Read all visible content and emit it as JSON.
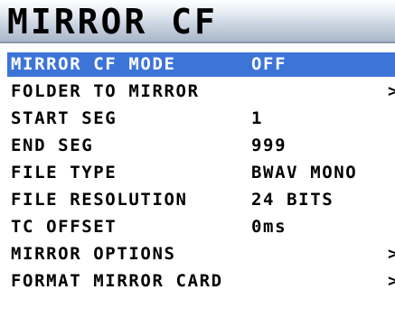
{
  "title": "MIRROR CF",
  "menu": {
    "items": [
      {
        "label": "MIRROR CF MODE",
        "value": "OFF",
        "selected": true,
        "submenu": false
      },
      {
        "label": "FOLDER TO MIRROR",
        "value": "",
        "selected": false,
        "submenu": true,
        "chevron": ">"
      },
      {
        "label": "START SEG",
        "value": "1",
        "selected": false,
        "submenu": false
      },
      {
        "label": "END SEG",
        "value": "999",
        "selected": false,
        "submenu": false
      },
      {
        "label": "FILE TYPE",
        "value": "BWAV MONO",
        "selected": false,
        "submenu": false
      },
      {
        "label": "FILE RESOLUTION",
        "value": "24 BITS",
        "selected": false,
        "submenu": false
      },
      {
        "label": "TC OFFSET",
        "value": "0ms",
        "selected": false,
        "submenu": false
      },
      {
        "label": "MIRROR OPTIONS",
        "value": "",
        "selected": false,
        "submenu": true,
        "chevron": ">"
      },
      {
        "label": "FORMAT MIRROR CARD",
        "value": "",
        "selected": false,
        "submenu": true,
        "chevron": ">"
      }
    ]
  },
  "colors": {
    "selection_bg": "#3c74d8",
    "selection_text": "#ffffff",
    "text": "#000000",
    "background": "#ffffff"
  }
}
